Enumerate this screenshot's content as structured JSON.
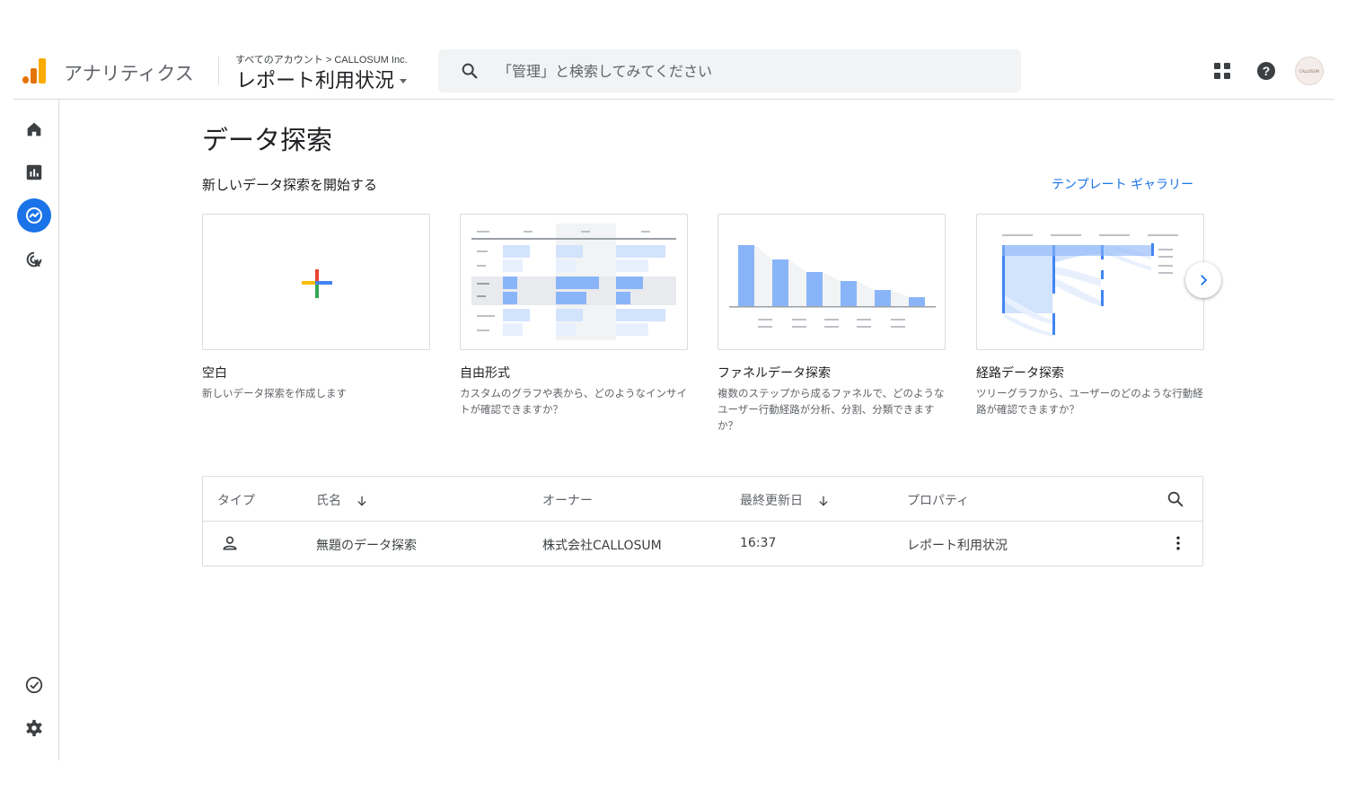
{
  "header": {
    "product_name": "アナリティクス",
    "breadcrumb": "すべてのアカウント > CALLOSUM Inc.",
    "property_name": "レポート利用状況",
    "search_placeholder": "「管理」と検索してみてください",
    "avatar_text": "CALLOSUM"
  },
  "page": {
    "title": "データ探索",
    "section_title": "新しいデータ探索を開始する",
    "gallery_link": "テンプレート ギャラリー"
  },
  "templates": [
    {
      "title": "空白",
      "description": "新しいデータ探索を作成します"
    },
    {
      "title": "自由形式",
      "description": "カスタムのグラフや表から、どのようなインサイトが確認できますか？"
    },
    {
      "title": "ファネルデータ探索",
      "description": "複数のステップから成るファネルで、どのようなユーザー行動経路が分析、分割、分類できますか？"
    },
    {
      "title": "経路データ探索",
      "description": "ツリーグラフから、ユーザーのどのような行動経路が確認できますか？"
    }
  ],
  "table": {
    "columns": [
      "タイプ",
      "氏名",
      "オーナー",
      "最終更新日",
      "プロパティ"
    ],
    "rows": [
      {
        "type_icon": "person-icon",
        "name": "無題のデータ探索",
        "owner": "株式会社CALLOSUM",
        "updated": "16:37",
        "property": "レポート利用状況"
      }
    ]
  },
  "colors": {
    "accent": "#1a73e8",
    "logo_orange": "#f9ab00",
    "logo_dark_orange": "#e37400",
    "chart_blue": "#8ab4f8",
    "chart_light_blue": "#d2e3fc"
  },
  "icons": {
    "nav": [
      "home-icon",
      "reports-icon",
      "explore-icon",
      "advertising-icon",
      "insights-check-icon",
      "settings-gear-icon"
    ],
    "header": [
      "apps-grid-icon",
      "help-icon"
    ]
  }
}
